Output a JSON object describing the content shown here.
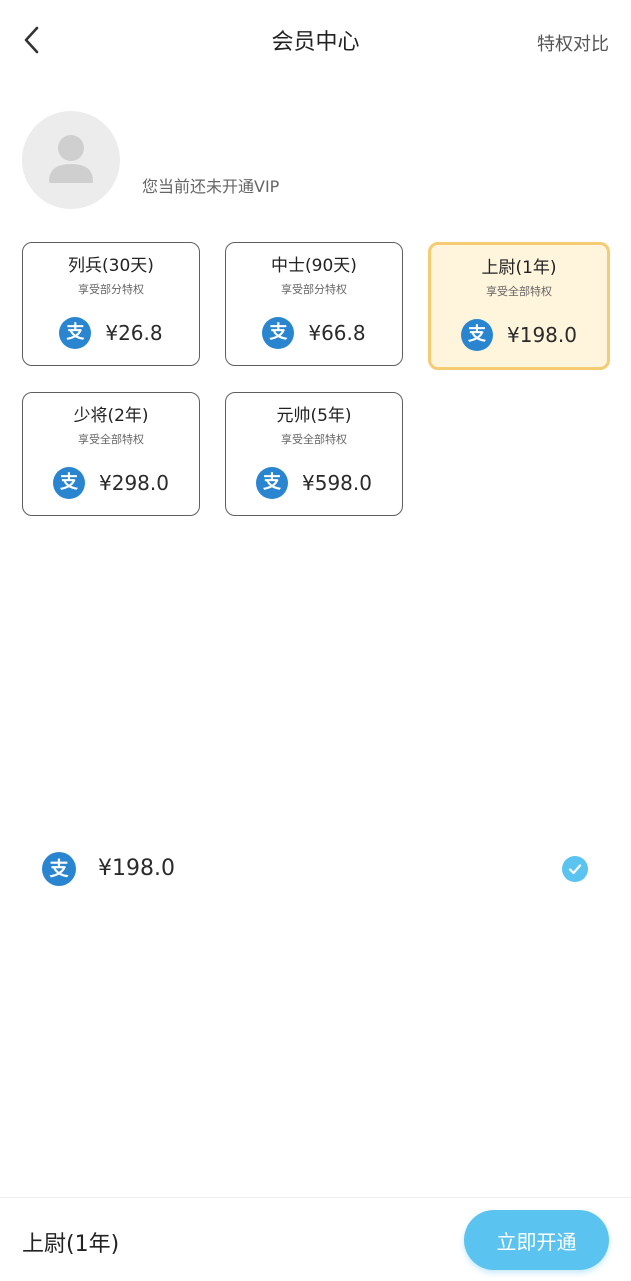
{
  "header": {
    "title": "会员中心",
    "compare_label": "特权对比",
    "back_icon": "chevron-left-icon"
  },
  "user": {
    "avatar_icon": "user-avatar-placeholder",
    "status_text": "您当前还未开通VIP"
  },
  "plans": [
    {
      "name": "列兵(30天)",
      "desc": "享受部分特权",
      "price": "¥26.8",
      "selected": false
    },
    {
      "name": "中士(90天)",
      "desc": "享受部分特权",
      "price": "¥66.8",
      "selected": false
    },
    {
      "name": "上尉(1年)",
      "desc": "享受全部特权",
      "price": "¥198.0",
      "selected": true
    },
    {
      "name": "少将(2年)",
      "desc": "享受全部特权",
      "price": "¥298.0",
      "selected": false
    },
    {
      "name": "元帅(5年)",
      "desc": "享受全部特权",
      "price": "¥598.0",
      "selected": false
    }
  ],
  "payment": {
    "method_icon": "alipay-icon",
    "amount": "¥198.0",
    "selected": true
  },
  "bottom": {
    "selected_plan": "上尉(1年)",
    "open_button_label": "立即开通"
  },
  "colors": {
    "accent": "#5bc3f0",
    "selected_card_bg": "#fff4dc",
    "selected_card_border": "#f5cb73",
    "alipay_blue": "#2a85d0"
  }
}
